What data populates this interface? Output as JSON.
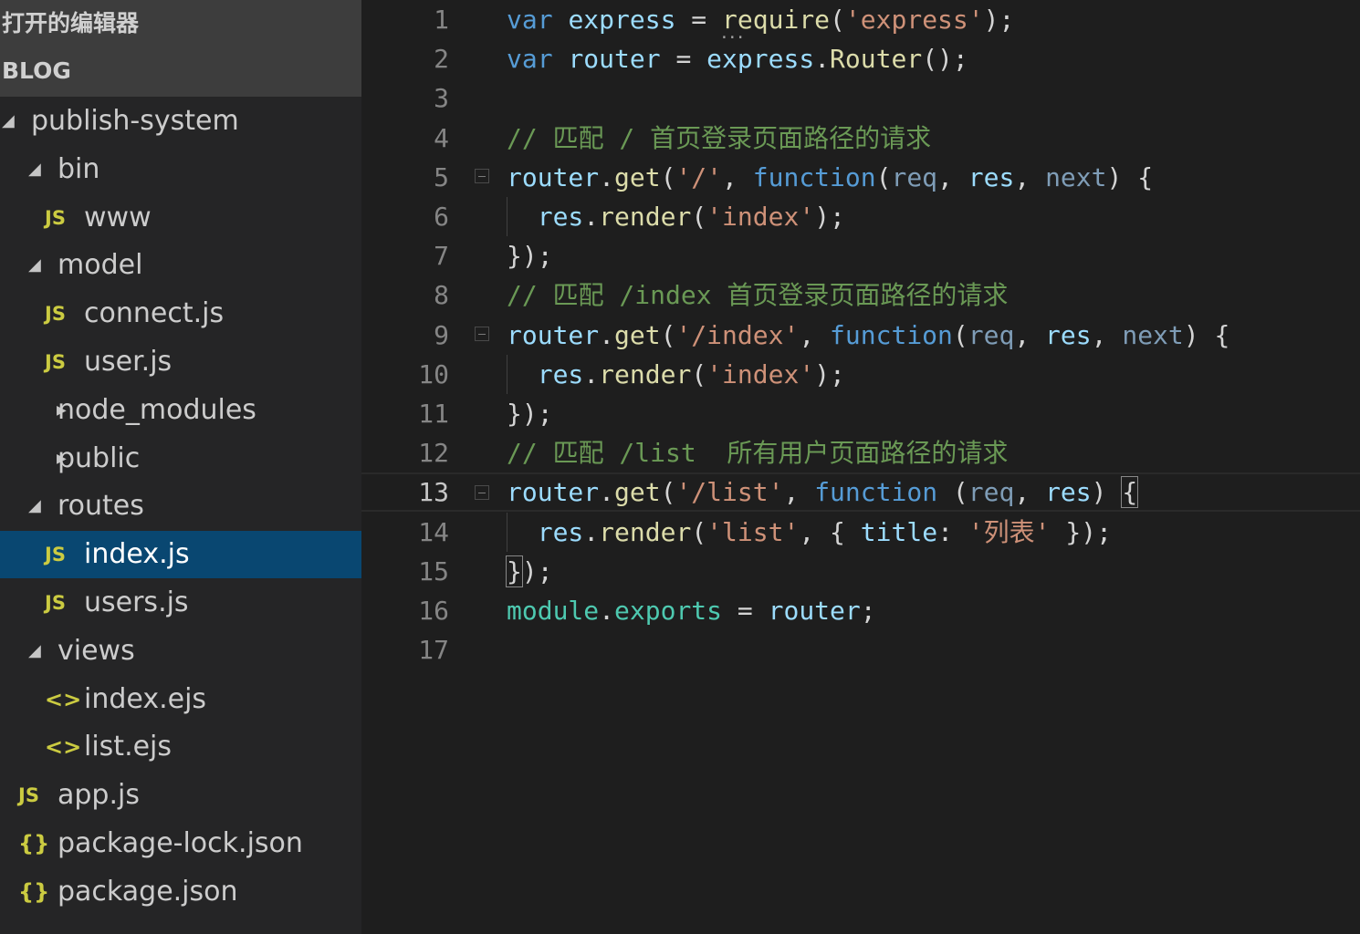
{
  "explorer": {
    "open_editors_title": "打开的编辑器",
    "project_title": "BLOG"
  },
  "tree": [
    {
      "label": "publish-system",
      "kind": "folder",
      "expanded": true,
      "depth": 0
    },
    {
      "label": "bin",
      "kind": "folder",
      "expanded": true,
      "depth": 1
    },
    {
      "label": "www",
      "kind": "js",
      "depth": 2
    },
    {
      "label": "model",
      "kind": "folder",
      "expanded": true,
      "depth": 1
    },
    {
      "label": "connect.js",
      "kind": "js",
      "depth": 2
    },
    {
      "label": "user.js",
      "kind": "js",
      "depth": 2
    },
    {
      "label": "node_modules",
      "kind": "folder",
      "expanded": false,
      "depth": 1
    },
    {
      "label": "public",
      "kind": "folder",
      "expanded": false,
      "depth": 1
    },
    {
      "label": "routes",
      "kind": "folder",
      "expanded": true,
      "depth": 1
    },
    {
      "label": "index.js",
      "kind": "js",
      "depth": 2,
      "selected": true
    },
    {
      "label": "users.js",
      "kind": "js",
      "depth": 2
    },
    {
      "label": "views",
      "kind": "folder",
      "expanded": true,
      "depth": 1
    },
    {
      "label": "index.ejs",
      "kind": "ejs",
      "depth": 2
    },
    {
      "label": "list.ejs",
      "kind": "ejs",
      "depth": 2
    },
    {
      "label": "app.js",
      "kind": "js",
      "depth": 1
    },
    {
      "label": "package-lock.json",
      "kind": "json",
      "depth": 1
    },
    {
      "label": "package.json",
      "kind": "json",
      "depth": 1
    }
  ],
  "icons": {
    "expanded": "▲",
    "collapsed": "▶",
    "js": "JS",
    "ejs": "<>",
    "json": "{}"
  },
  "editor": {
    "current_line": 13,
    "lines": [
      [
        [
          "kw",
          "var "
        ],
        [
          "var",
          "express"
        ],
        [
          "plain",
          " = "
        ],
        [
          "fn",
          "require",
          "hint"
        ],
        [
          "plain",
          "("
        ],
        [
          "str",
          "'express'"
        ],
        [
          "plain",
          ");"
        ]
      ],
      [
        [
          "kw",
          "var "
        ],
        [
          "var",
          "router"
        ],
        [
          "plain",
          " = "
        ],
        [
          "var",
          "express"
        ],
        [
          "plain",
          "."
        ],
        [
          "fn",
          "Router"
        ],
        [
          "plain",
          "();"
        ]
      ],
      [],
      [
        [
          "com",
          "// 匹配 / 首页登录页面路径的请求"
        ]
      ],
      [
        [
          "var",
          "router"
        ],
        [
          "plain",
          "."
        ],
        [
          "fn",
          "get"
        ],
        [
          "plain",
          "("
        ],
        [
          "str",
          "'/'"
        ],
        [
          "plain",
          ", "
        ],
        [
          "kw",
          "function"
        ],
        [
          "plain",
          "("
        ],
        [
          "param",
          "req"
        ],
        [
          "plain",
          ", "
        ],
        [
          "var",
          "res"
        ],
        [
          "plain",
          ", "
        ],
        [
          "param",
          "next"
        ],
        [
          "plain",
          ") {"
        ]
      ],
      [
        [
          "plain",
          "  "
        ],
        [
          "var",
          "res"
        ],
        [
          "plain",
          "."
        ],
        [
          "fn",
          "render"
        ],
        [
          "plain",
          "("
        ],
        [
          "str",
          "'index'"
        ],
        [
          "plain",
          ");"
        ]
      ],
      [
        [
          "plain",
          "});"
        ]
      ],
      [
        [
          "com",
          "// 匹配 /index 首页登录页面路径的请求"
        ]
      ],
      [
        [
          "var",
          "router"
        ],
        [
          "plain",
          "."
        ],
        [
          "fn",
          "get"
        ],
        [
          "plain",
          "("
        ],
        [
          "str",
          "'/index'"
        ],
        [
          "plain",
          ", "
        ],
        [
          "kw",
          "function"
        ],
        [
          "plain",
          "("
        ],
        [
          "param",
          "req"
        ],
        [
          "plain",
          ", "
        ],
        [
          "var",
          "res"
        ],
        [
          "plain",
          ", "
        ],
        [
          "param",
          "next"
        ],
        [
          "plain",
          ") {"
        ]
      ],
      [
        [
          "plain",
          "  "
        ],
        [
          "var",
          "res"
        ],
        [
          "plain",
          "."
        ],
        [
          "fn",
          "render"
        ],
        [
          "plain",
          "("
        ],
        [
          "str",
          "'index'"
        ],
        [
          "plain",
          ");"
        ]
      ],
      [
        [
          "plain",
          "});"
        ]
      ],
      [
        [
          "com",
          "// 匹配 /list  所有用户页面路径的请求"
        ]
      ],
      [
        [
          "var",
          "router"
        ],
        [
          "plain",
          "."
        ],
        [
          "fn",
          "get"
        ],
        [
          "plain",
          "("
        ],
        [
          "str",
          "'/list'"
        ],
        [
          "plain",
          ", "
        ],
        [
          "kw",
          "function"
        ],
        [
          "plain",
          " ("
        ],
        [
          "param",
          "req"
        ],
        [
          "plain",
          ", "
        ],
        [
          "var",
          "res"
        ],
        [
          "plain",
          ") "
        ],
        [
          "plain",
          "{",
          "brace"
        ]
      ],
      [
        [
          "plain",
          "  "
        ],
        [
          "var",
          "res"
        ],
        [
          "plain",
          "."
        ],
        [
          "fn",
          "render"
        ],
        [
          "plain",
          "("
        ],
        [
          "str",
          "'list'"
        ],
        [
          "plain",
          ", { "
        ],
        [
          "var",
          "title"
        ],
        [
          "plain",
          ": "
        ],
        [
          "str",
          "'列表'"
        ],
        [
          "plain",
          " });"
        ]
      ],
      [
        [
          "plain",
          "}",
          "brace"
        ],
        [
          "plain",
          ");"
        ]
      ],
      [
        [
          "mod",
          "module"
        ],
        [
          "plain",
          "."
        ],
        [
          "mod",
          "exports"
        ],
        [
          "plain",
          " = "
        ],
        [
          "var",
          "router"
        ],
        [
          "plain",
          ";"
        ]
      ],
      []
    ]
  }
}
